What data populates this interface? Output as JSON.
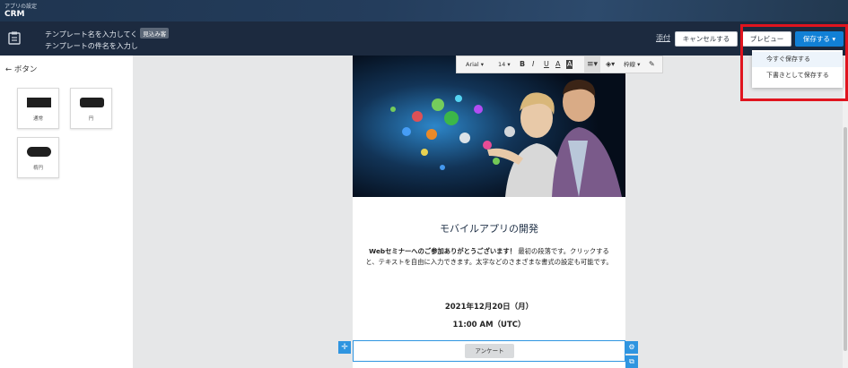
{
  "appbar": {
    "breadcrumb": "アプリの設定",
    "app_name": "CRM"
  },
  "template": {
    "name_placeholder": "テンプレート名を入力してく",
    "badge": "見込み客",
    "subject_placeholder": "テンプレートの件名を入力し"
  },
  "header_actions": {
    "attach": "添付",
    "cancel": "キャンセルする",
    "preview": "プレビュー",
    "save": "保存する",
    "save_caret": "▾"
  },
  "save_menu": {
    "items": [
      "今すぐ保存する",
      "下書きとして保存する"
    ]
  },
  "left_panel": {
    "back_label": "ボタン",
    "button_styles": [
      "通常",
      "円",
      "楕円"
    ]
  },
  "toolbar": {
    "font": "Arial",
    "size": "14",
    "bold": "B",
    "italic": "I",
    "underline": "U",
    "text_color": "A",
    "bg_color": "A",
    "align": "≡",
    "frame": "枠線"
  },
  "email": {
    "title": "モバイルアプリの開発",
    "body_bold": "Webセミナーへのご参加ありがとうございます！",
    "body_rest": "最初の段落です。クリックすると、テキストを自由に入力できます。太字などのさまざまな書式の設定も可能です。",
    "date": "2021年12月20日（月）",
    "time": "11:00 AM（UTC）",
    "button_label": "アンケート"
  },
  "colors": {
    "header_bg": "#1c2a3f",
    "save_button": "#1180d6",
    "highlight": "#e0141e",
    "selection": "#2f95e0"
  },
  "icons": [
    "template-icon",
    "back-arrow-icon",
    "move-icon",
    "gear-icon",
    "copy-icon",
    "caret-down-icon"
  ]
}
